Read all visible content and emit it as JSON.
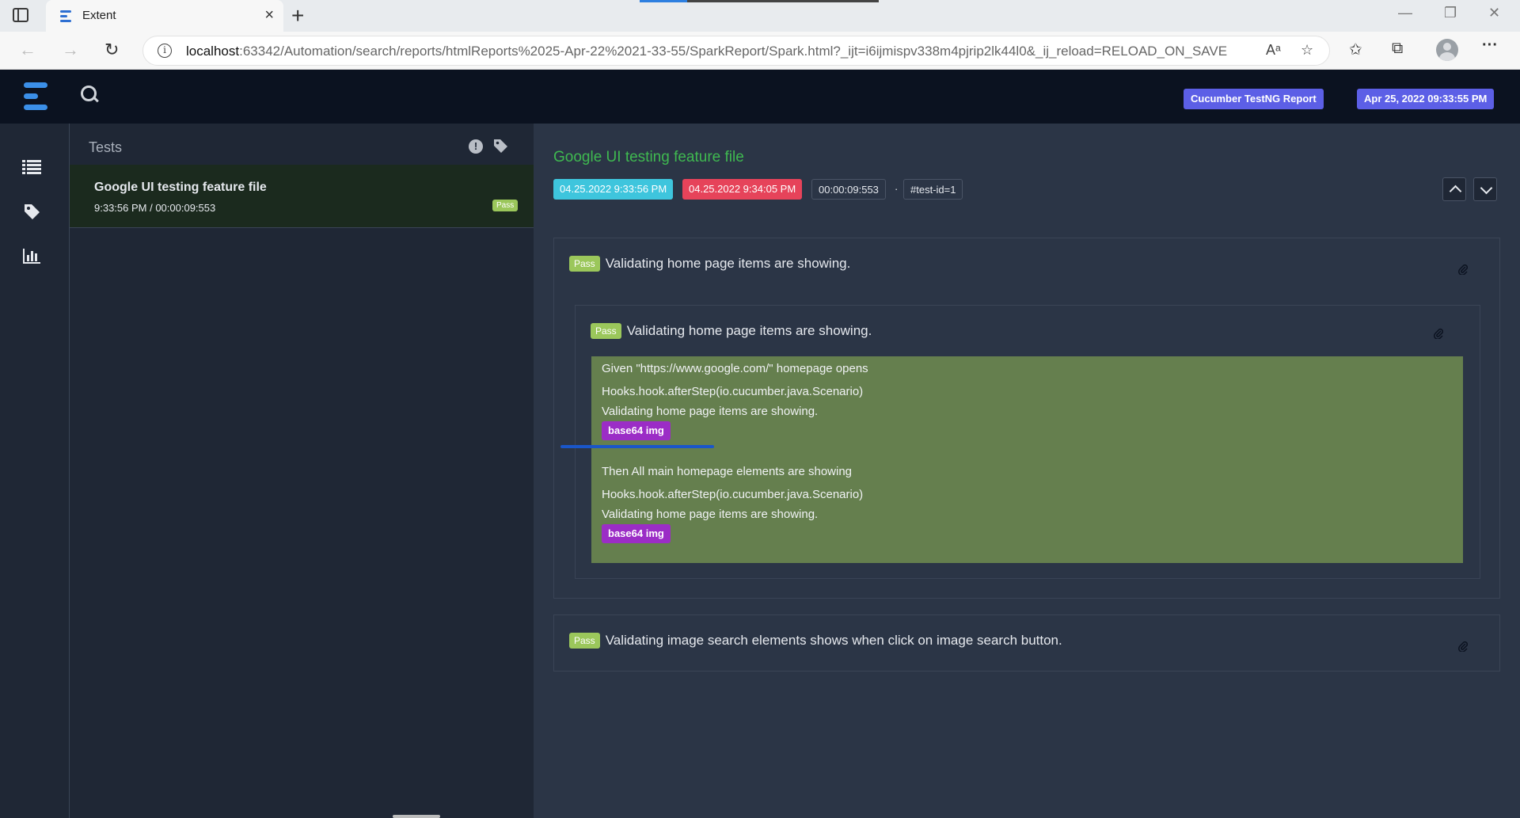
{
  "browser": {
    "tab_title": "Extent",
    "url_host": "localhost",
    "url_rest": ":63342/Automation/search/reports/htmlReports%2025-Apr-22%2021-33-55/SparkReport/Spark.html?_ijt=i6ijmispv338m4pjrip2lk44l0&_ij_reload=RELOAD_ON_SAVE"
  },
  "header": {
    "badge_report": "Cucumber TestNG Report",
    "badge_date": "Apr 25, 2022 09:33:55 PM"
  },
  "tests_panel": {
    "title": "Tests",
    "items": [
      {
        "name": "Google UI testing feature file",
        "time": "9:33:56 PM / 00:00:09:553",
        "status": "Pass"
      }
    ]
  },
  "detail": {
    "title": "Google UI testing feature file",
    "start": "04.25.2022 9:33:56 PM",
    "end": "04.25.2022 9:34:05 PM",
    "duration": "00:00:09:553",
    "separator": "·",
    "test_id": "#test-id=1",
    "scenarios": [
      {
        "status": "Pass",
        "title": "Validating home page items are showing.",
        "inner": {
          "status": "Pass",
          "title": "Validating home page items are showing.",
          "log": [
            "Given \"https://www.google.com/\" homepage opens",
            "Hooks.hook.afterStep(io.cucumber.java.Scenario)",
            "Validating home page items are showing.",
            "base64 img",
            "Then All main homepage elements are showing",
            "Hooks.hook.afterStep(io.cucumber.java.Scenario)",
            "Validating home page items are showing.",
            "base64 img"
          ]
        }
      },
      {
        "status": "Pass",
        "title": "Validating image search elements shows when click on image search button."
      }
    ]
  },
  "colors": {
    "app_header": "#0b1220",
    "panel": "#1f2735",
    "detail_bg": "#2b3546",
    "pass": "#9bc75b",
    "title_green": "#3fb950",
    "start_badge": "#3ec5dd",
    "end_badge": "#e6435a",
    "log_bg": "#657f4e",
    "b64_badge": "#9b2dc6",
    "header_badge": "#5c5fe6"
  }
}
